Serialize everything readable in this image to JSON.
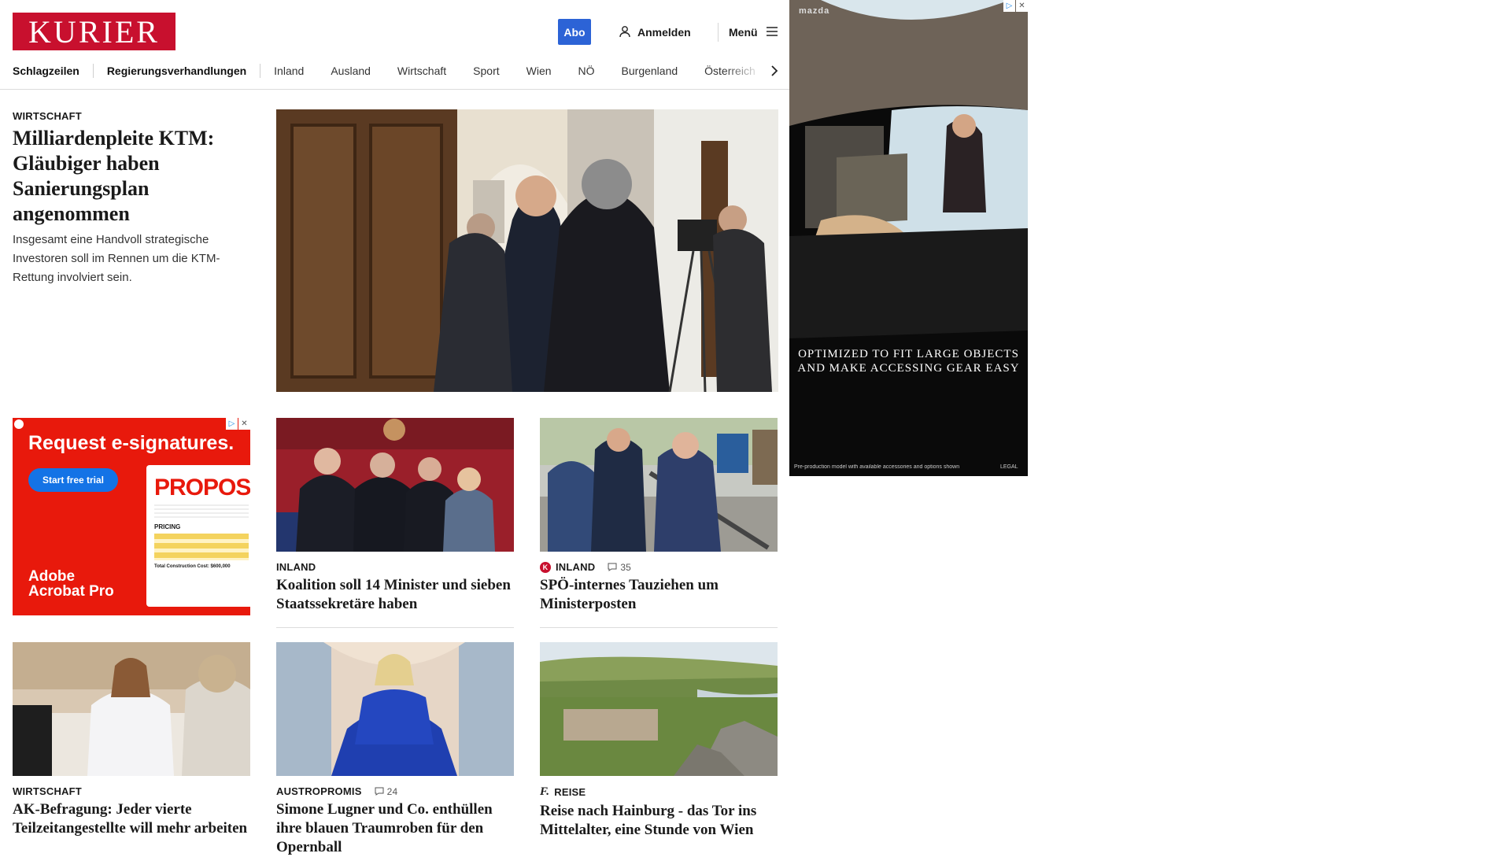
{
  "header": {
    "logo_text": "KURIER",
    "abo_label": "Abo",
    "login_label": "Anmelden",
    "menu_label": "Menü"
  },
  "nav": {
    "items": [
      "Schlagzeilen",
      "Regierungsverhandlungen",
      "Inland",
      "Ausland",
      "Wirtschaft",
      "Sport",
      "Wien",
      "NÖ",
      "Burgenland",
      "Österreich"
    ]
  },
  "lead": {
    "kicker": "WIRTSCHAFT",
    "title": "Milliardenpleite KTM: Gläubiger haben Sanierungsplan angenommen",
    "teaser": "Insgesamt eine Handvoll strategische Investoren soll im Rennen um die KTM-Rettung involviert sein.",
    "image_alt": "Politicians entering a building through a wooden door, camera crews filming"
  },
  "cards": [
    {
      "kicker": "INLAND",
      "title": "Koalition soll 14 Minister und sieben Staatssekretäre haben",
      "comments": ""
    },
    {
      "kicker": "INLAND",
      "title": "SPÖ-internes Tauziehen um Ministerposten",
      "comments": "35",
      "badge": "K"
    },
    {
      "kicker": "WIRTSCHAFT",
      "title": "AK-Befragung: Jeder vierte Teilzeitangestellte will mehr arbeiten",
      "comments": ""
    },
    {
      "kicker": "AUSTROPROMIS",
      "title": "Simone Lugner und Co. enthüllen ihre blauen Traumroben für den Opernball",
      "comments": "24"
    },
    {
      "kicker": "REISE",
      "title": "Reise nach Hainburg - das Tor ins Mittelalter, eine Stunde von Wien",
      "comments": "",
      "badge": "f."
    }
  ],
  "ad_left": {
    "headline": "Request e-signatures.",
    "cta": "Start free trial",
    "doc_title": "PROPOSAL",
    "doc_section": "PRICING",
    "doc_total": "Total Construction Cost: $600,000",
    "brand_line1": "Adobe",
    "brand_line2": "Acrobat Pro"
  },
  "ad_right": {
    "tagline": "OPTIMIZED TO FIT LARGE OBJECTS AND MAKE ACCESSING GEAR EASY",
    "disclaimer": "Pre-production model with available accessories and options shown",
    "legal": "LEGAL",
    "brand": "mazda"
  },
  "colors": {
    "brand_red": "#c8102e",
    "abo_blue": "#2c63d6",
    "ad_red": "#e8190c",
    "cta_blue": "#1473e6"
  }
}
